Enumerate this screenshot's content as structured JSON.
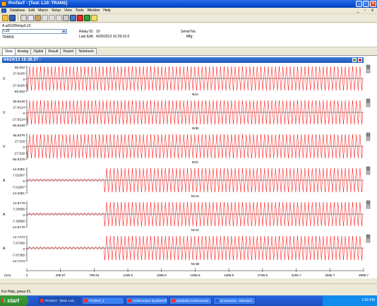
{
  "window": {
    "title": "ProTesT - [Test: L10: TRANS]",
    "controls": [
      "_",
      "▫",
      "x"
    ]
  },
  "menubar": {
    "items": [
      "Database",
      "Edit",
      "Macro",
      "Setup",
      "View",
      "Tools",
      "Window",
      "Help"
    ],
    "mdi_controls": "_ ▫ x"
  },
  "toolbar": {
    "buttons": [
      "open-icon",
      "save-icon",
      "cut-icon",
      "copy-icon",
      "paste-icon",
      "undo-icon",
      "redo-icon",
      "find-icon",
      "print-icon",
      "report-icon",
      "test-icon",
      "chart-icon",
      "help-icon"
    ]
  },
  "info": {
    "path": "A.all/10/Relay/L10",
    "relay_select": "L10",
    "relay_name": "TRANS",
    "relay_id_label": "Relay ID:",
    "relay_id_value": "10",
    "last_edit_label": "Last Edit:",
    "last_edit_value": "4/26/2013 10:29:10.0",
    "serial_label": "Serial No:",
    "mfg_label": "Mfg:"
  },
  "tabs": [
    "View",
    "Analog",
    "Digital",
    "Result",
    "Report",
    "Notebook"
  ],
  "plot_header": "04/24/13 19:38:27 -",
  "colors": {
    "wave": "#ff0000",
    "axis": "#000000",
    "header": "#1c56b8"
  },
  "channels": [
    {
      "name": "N/IA",
      "unit": "V",
      "ticks": [
        "55.833",
        "27.9165",
        "0",
        "-27.9165",
        "-55.833"
      ],
      "pre": 1.0
    },
    {
      "name": "N/IB",
      "unit": "V",
      "ticks": [
        "55.8248",
        "27.9124",
        "0",
        "-27.9124",
        "-55.8248"
      ],
      "pre": 1.0
    },
    {
      "name": "N/IC",
      "unit": "V",
      "ticks": [
        "55.8379",
        "27.919",
        "0",
        "-27.919",
        "-55.8379"
      ],
      "pre": 1.0
    },
    {
      "name": "NCIA",
      "unit": "A",
      "ticks": [
        "14.0381",
        "7.01907",
        "0",
        "-7.01907",
        "-14.0381"
      ],
      "pre": 0.12
    },
    {
      "name": "NCIC",
      "unit": "A",
      "ticks": [
        "14.6779",
        "7.33895",
        "0",
        "-7.33895",
        "-14.6779"
      ],
      "pre": 0.12
    },
    {
      "name": "NCIB",
      "unit": "A",
      "ticks": [
        "14.7473",
        "7.67365",
        "0",
        "-7.67365",
        "-14.7473"
      ],
      "pre": 0.12
    }
  ],
  "time_axis": {
    "unit": "(ms)",
    "labels": [
      "0",
      "398.97",
      "798.94",
      "1198.9",
      "1598.9",
      "1998.8",
      "2398.8",
      "2798.8",
      "3198.7",
      "3598.7",
      "3998.7"
    ],
    "step_index": 2.3
  },
  "statusbar": "For Help, press F1",
  "taskbar": {
    "start": "start",
    "tasks": [
      "ProTesT - [Test: L10...",
      "ProTesT_1",
      "AcSELerator QuickSet®",
      "QuickSet Communicat...",
      "Document1 - Microsof..."
    ],
    "clock": "1:05 PM"
  }
}
